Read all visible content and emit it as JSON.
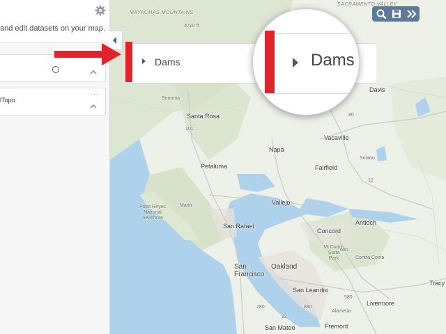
{
  "panel": {
    "description": "and edit datasets on your map.",
    "card2_title": "lTopo",
    "more_glyph": "···"
  },
  "highlight": {
    "layer_label": "Dams",
    "accent_color": "#e1232b"
  },
  "toolbar": {
    "icons": [
      "search-icon",
      "save-icon",
      "double-chevron-icon"
    ]
  },
  "map": {
    "labels": {
      "mayacmas": "MAYACMAS MOUNTAINS",
      "sacramento_valley": "SACRAMENTO VALLEY",
      "elev": "4710 ft",
      "sonoma": "Sonoma",
      "santa_rosa": "Santa Rosa",
      "napa": "Napa",
      "vacaville": "Vacaville",
      "davis": "Davis",
      "fairfield": "Fairfield",
      "solano": "Solano",
      "petaluma": "Petaluma",
      "marin": "Marin",
      "point_reyes": "Point Reyes National Seashore",
      "vallejo": "Vallejo",
      "san_rafael": "San Rafael",
      "concord": "Concord",
      "antioch": "Antioch",
      "mt_diablo": "Mt Diablo State Park",
      "contra_costa": "Contra Costa",
      "san_francisco": "San Francisco",
      "oakland": "Oakland",
      "san_leandro": "San Leandro",
      "livermore": "Livermore",
      "tracy": "Tracy",
      "alameda": "Alameda",
      "fremont": "Fremont",
      "san_mateo": "San Mateo",
      "hwy_101": "101",
      "hwy_80": "80",
      "hwy_12": "12",
      "hwy_680": "680",
      "hwy_580": "580",
      "hwy_880": "880",
      "hwy_280": "280",
      "hwy_92": "92"
    }
  }
}
